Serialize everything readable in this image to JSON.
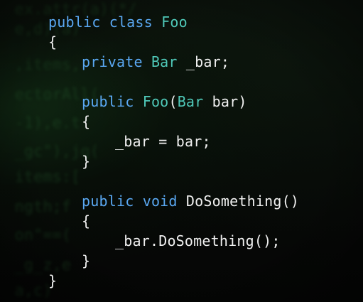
{
  "code": {
    "line1": {
      "kw1": "public",
      "kw2": "class",
      "type": "Foo"
    },
    "open_brace_class": "{",
    "field": {
      "kw": "private",
      "type": "Bar",
      "name": "_bar",
      "semi": ";"
    },
    "ctor": {
      "kw": "public",
      "type": "Foo",
      "lparen": "(",
      "param_type": "Bar",
      "param_name": "bar",
      "rparen": ")"
    },
    "open_brace_ctor": "{",
    "assign": {
      "lhs": "_bar",
      "op": "=",
      "rhs": "bar",
      "semi": ";"
    },
    "close_brace_ctor": "}",
    "method": {
      "kw1": "public",
      "kw2": "void",
      "name": "DoSomething",
      "parens": "()"
    },
    "open_brace_method": "{",
    "call": {
      "text": "_bar.DoSomething();"
    },
    "close_brace_method": "}",
    "close_brace_class": "}"
  },
  "colors": {
    "keyword": "#5aa8f2",
    "type": "#4fc8b8",
    "text": "#f0f0f0",
    "background": "#070907"
  }
}
